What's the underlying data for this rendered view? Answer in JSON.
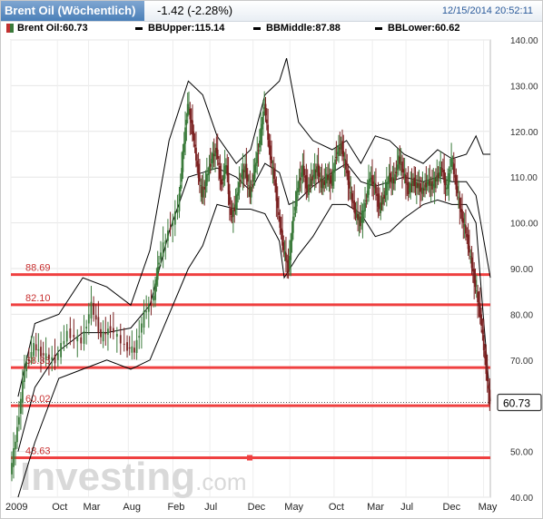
{
  "header": {
    "title": "Brent Oil (Wöchentlich)",
    "change": "-1.42 (-2.28%)",
    "timestamp": "12/15/2014 20:52:11"
  },
  "legend": {
    "brent": "Brent Oil:60.73",
    "bbupper": "BBUpper:115.14",
    "bbmiddle": "BBMiddle:87.88",
    "bblower": "BBLower:60.62"
  },
  "watermark": "Investing.com",
  "colors": {
    "up": "#3a7a3a",
    "down": "#7a2020",
    "level_line": "#ef4040",
    "band": "#000000",
    "current_tag": "#333333"
  },
  "chart_data": {
    "type": "candlestick",
    "ylim": [
      40,
      140
    ],
    "y_ticks": [
      "140.00",
      "130.00",
      "120.00",
      "110.00",
      "100.00",
      "90.00",
      "80.00",
      "70.00",
      "60.00",
      "50.00",
      "40.00"
    ],
    "y_tick_values": [
      140,
      130,
      120,
      110,
      100,
      90,
      80,
      70,
      60,
      50,
      40
    ],
    "x_tick_labels": [
      "2009",
      "Oct",
      "Mar",
      "Aug",
      "Feb",
      "Jul",
      "Dec",
      "May",
      "Oct",
      "Mar",
      "Jul",
      "Dec",
      "May"
    ],
    "x_tick_positions": [
      0.0,
      0.097,
      0.162,
      0.245,
      0.338,
      0.415,
      0.505,
      0.582,
      0.674,
      0.754,
      0.824,
      0.912,
      0.986
    ],
    "current_price": "60.73",
    "levels": [
      {
        "value": 88.69,
        "label": "88.69"
      },
      {
        "value": 82.1,
        "label": "82.10"
      },
      {
        "value": 68.35,
        "label": "68.35"
      },
      {
        "value": 60.02,
        "label": "60.02"
      },
      {
        "value": 48.63,
        "label": "48.63"
      }
    ],
    "close_path": [
      [
        0.0,
        45
      ],
      [
        0.015,
        55
      ],
      [
        0.03,
        68
      ],
      [
        0.05,
        73
      ],
      [
        0.07,
        71
      ],
      [
        0.095,
        70
      ],
      [
        0.12,
        76
      ],
      [
        0.15,
        74
      ],
      [
        0.17,
        82
      ],
      [
        0.19,
        75
      ],
      [
        0.21,
        77
      ],
      [
        0.24,
        73
      ],
      [
        0.26,
        72
      ],
      [
        0.28,
        80
      ],
      [
        0.3,
        84
      ],
      [
        0.31,
        92
      ],
      [
        0.33,
        98
      ],
      [
        0.35,
        103
      ],
      [
        0.36,
        115
      ],
      [
        0.37,
        126
      ],
      [
        0.38,
        120
      ],
      [
        0.39,
        112
      ],
      [
        0.4,
        106
      ],
      [
        0.41,
        110
      ],
      [
        0.42,
        114
      ],
      [
        0.43,
        116
      ],
      [
        0.44,
        108
      ],
      [
        0.45,
        113
      ],
      [
        0.46,
        101
      ],
      [
        0.47,
        104
      ],
      [
        0.48,
        110
      ],
      [
        0.49,
        112
      ],
      [
        0.5,
        106
      ],
      [
        0.51,
        112
      ],
      [
        0.52,
        118
      ],
      [
        0.53,
        126
      ],
      [
        0.54,
        116
      ],
      [
        0.55,
        110
      ],
      [
        0.56,
        101
      ],
      [
        0.57,
        94
      ],
      [
        0.58,
        90
      ],
      [
        0.59,
        101
      ],
      [
        0.6,
        108
      ],
      [
        0.61,
        112
      ],
      [
        0.62,
        107
      ],
      [
        0.63,
        110
      ],
      [
        0.64,
        112
      ],
      [
        0.65,
        108
      ],
      [
        0.66,
        110
      ],
      [
        0.67,
        109
      ],
      [
        0.68,
        115
      ],
      [
        0.69,
        117
      ],
      [
        0.7,
        112
      ],
      [
        0.71,
        106
      ],
      [
        0.72,
        102
      ],
      [
        0.73,
        100
      ],
      [
        0.74,
        104
      ],
      [
        0.75,
        110
      ],
      [
        0.76,
        108
      ],
      [
        0.77,
        103
      ],
      [
        0.78,
        106
      ],
      [
        0.79,
        110
      ],
      [
        0.8,
        109
      ],
      [
        0.81,
        114
      ],
      [
        0.82,
        111
      ],
      [
        0.83,
        107
      ],
      [
        0.84,
        109
      ],
      [
        0.85,
        108
      ],
      [
        0.86,
        107
      ],
      [
        0.87,
        109
      ],
      [
        0.88,
        108
      ],
      [
        0.89,
        110
      ],
      [
        0.9,
        112
      ],
      [
        0.91,
        107
      ],
      [
        0.92,
        114
      ],
      [
        0.93,
        108
      ],
      [
        0.94,
        102
      ],
      [
        0.95,
        98
      ],
      [
        0.96,
        92
      ],
      [
        0.97,
        86
      ],
      [
        0.98,
        80
      ],
      [
        0.99,
        70
      ],
      [
        1.0,
        60.73
      ]
    ],
    "bb_upper": [
      [
        0.015,
        62
      ],
      [
        0.05,
        78
      ],
      [
        0.1,
        80
      ],
      [
        0.15,
        88
      ],
      [
        0.2,
        86
      ],
      [
        0.25,
        82
      ],
      [
        0.29,
        94
      ],
      [
        0.33,
        118
      ],
      [
        0.37,
        131
      ],
      [
        0.4,
        128
      ],
      [
        0.43,
        119
      ],
      [
        0.47,
        113
      ],
      [
        0.5,
        116
      ],
      [
        0.53,
        128
      ],
      [
        0.56,
        131
      ],
      [
        0.575,
        136
      ],
      [
        0.6,
        122
      ],
      [
        0.63,
        118
      ],
      [
        0.67,
        116
      ],
      [
        0.7,
        118
      ],
      [
        0.73,
        113
      ],
      [
        0.76,
        119
      ],
      [
        0.79,
        118
      ],
      [
        0.82,
        115
      ],
      [
        0.86,
        113
      ],
      [
        0.89,
        116
      ],
      [
        0.92,
        114
      ],
      [
        0.95,
        115
      ],
      [
        0.97,
        119
      ],
      [
        0.985,
        115
      ],
      [
        1.0,
        115
      ]
    ],
    "bb_middle": [
      [
        0.015,
        50
      ],
      [
        0.05,
        64
      ],
      [
        0.1,
        72
      ],
      [
        0.15,
        76
      ],
      [
        0.2,
        76
      ],
      [
        0.25,
        77
      ],
      [
        0.29,
        82
      ],
      [
        0.33,
        98
      ],
      [
        0.37,
        110
      ],
      [
        0.4,
        111
      ],
      [
        0.43,
        112
      ],
      [
        0.47,
        110
      ],
      [
        0.5,
        107
      ],
      [
        0.53,
        113
      ],
      [
        0.56,
        111
      ],
      [
        0.58,
        104
      ],
      [
        0.6,
        105
      ],
      [
        0.63,
        108
      ],
      [
        0.67,
        111
      ],
      [
        0.7,
        113
      ],
      [
        0.73,
        109
      ],
      [
        0.76,
        108
      ],
      [
        0.79,
        109
      ],
      [
        0.82,
        110
      ],
      [
        0.86,
        109
      ],
      [
        0.89,
        110
      ],
      [
        0.92,
        109
      ],
      [
        0.95,
        109
      ],
      [
        0.97,
        106
      ],
      [
        0.985,
        97
      ],
      [
        1.0,
        88
      ]
    ],
    "bb_lower": [
      [
        0.015,
        40
      ],
      [
        0.05,
        52
      ],
      [
        0.1,
        66
      ],
      [
        0.15,
        68
      ],
      [
        0.2,
        70
      ],
      [
        0.25,
        68
      ],
      [
        0.29,
        70
      ],
      [
        0.33,
        80
      ],
      [
        0.37,
        90
      ],
      [
        0.4,
        95
      ],
      [
        0.43,
        104
      ],
      [
        0.47,
        103
      ],
      [
        0.5,
        103
      ],
      [
        0.53,
        102
      ],
      [
        0.56,
        96
      ],
      [
        0.57,
        88
      ],
      [
        0.6,
        93
      ],
      [
        0.63,
        97
      ],
      [
        0.67,
        104
      ],
      [
        0.7,
        104
      ],
      [
        0.73,
        102
      ],
      [
        0.76,
        97
      ],
      [
        0.79,
        98
      ],
      [
        0.82,
        101
      ],
      [
        0.86,
        104
      ],
      [
        0.89,
        105
      ],
      [
        0.92,
        104
      ],
      [
        0.95,
        104
      ],
      [
        0.97,
        100
      ],
      [
        0.985,
        80
      ],
      [
        1.0,
        61
      ]
    ]
  }
}
